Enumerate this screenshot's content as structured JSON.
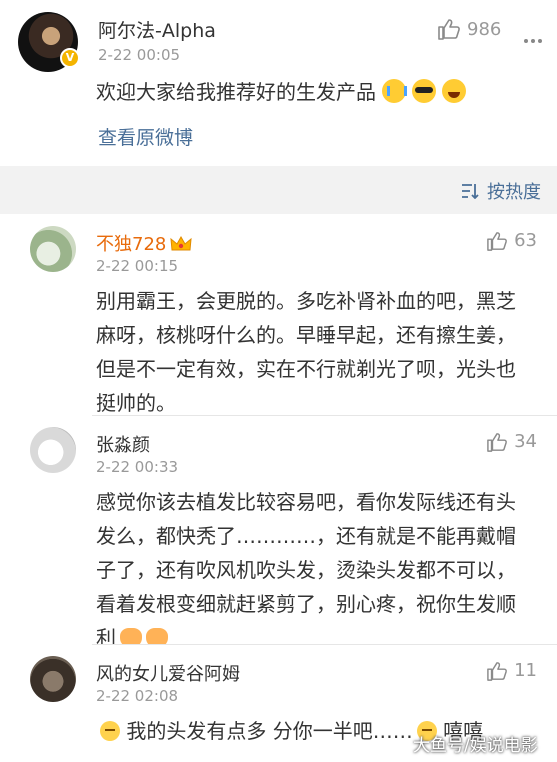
{
  "post": {
    "author": "阿尔法-Alpha",
    "time": "2-22 00:05",
    "likes": "986",
    "text": "欢迎大家给我推荐好的生发产品",
    "view_original": "查看原微博",
    "verified_badge": "V"
  },
  "sort": {
    "label": "按热度"
  },
  "comments": [
    {
      "name": "不独728",
      "time": "2-22 00:15",
      "likes": "63",
      "text": "别用霸王，会更脱的。多吃补肾补血的吧，黑芝麻呀，核桃呀什么的。早睡早起，还有擦生姜，但是不一定有效，实在不行就剃光了呗，光头也挺帅的。"
    },
    {
      "name": "张淼颜",
      "time": "2-22 00:33",
      "likes": "34",
      "text": "感觉你该去植发比较容易吧，看你发际线还有头发么，都快秃了…………，还有就是不能再戴帽子了，还有吹风机吹头发，烫染头发都不可以，看着发根变细就赶紧剪了，别心疼，祝你生发顺利"
    },
    {
      "name": "风的女儿爱谷阿姆",
      "time": "2-22 02:08",
      "likes": "11",
      "text": "我的头发有点多 分你一半吧……",
      "text_suffix": "嘻嘻"
    }
  ],
  "watermark": "大鱼号/娱说电影",
  "colors": {
    "link": "#4a6f98",
    "vip_name": "#e86b0c",
    "meta": "#999999",
    "band": "#f2f2f2"
  },
  "icons": [
    "thumbs-up-icon",
    "more-icon",
    "sort-icon",
    "crown-icon",
    "verified-badge-icon"
  ]
}
